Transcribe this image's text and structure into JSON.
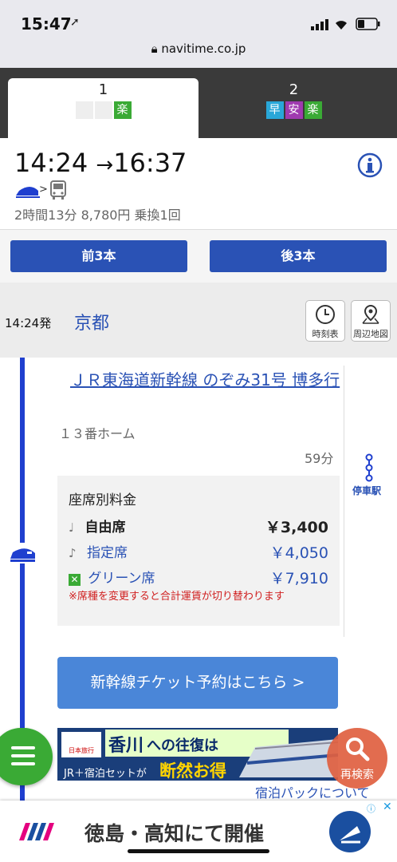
{
  "status": {
    "time": "15:47",
    "url": "navitime.co.jp"
  },
  "tabs": [
    {
      "num": "1",
      "badges": [
        "",
        "",
        "楽"
      ]
    },
    {
      "num": "2",
      "badges": [
        "早",
        "安",
        "楽"
      ]
    }
  ],
  "summary": {
    "depart": "14:24",
    "arrow": "→",
    "arrive": "16:37",
    "gt": ">",
    "details": "2時間13分 8,780円 乗換1回"
  },
  "nav": {
    "prev": "前3本",
    "next": "後3本"
  },
  "station": {
    "time": "14:24発",
    "name": "京都",
    "timetable": "時刻表",
    "map": "周辺地図"
  },
  "train": {
    "name": "ＪＲ東海道新幹線 のぞみ31号 博多行",
    "platform": "１３番ホーム",
    "duration": "59分",
    "stops": "停車駅"
  },
  "seats": {
    "title": "座席別料金",
    "rows": [
      {
        "label": "自由席",
        "price": "￥3,400"
      },
      {
        "label": "指定席",
        "price": "￥4,050"
      },
      {
        "label": "グリーン席",
        "price": "￥7,910"
      }
    ],
    "note": "※席種を変更すると合計運賃が切り替わります"
  },
  "ticket_button": "新幹線チケット予約はこちら >",
  "banner": {
    "logo": "日本旅行",
    "dest": "香川",
    "rest": "への往復は",
    "sub": "JR＋宿泊セットが",
    "strong": "断然お得"
  },
  "reroute": "再検索",
  "pack": "宿泊パックについて",
  "ad": {
    "text": "徳島・高知にて開催"
  },
  "colors": {
    "accent": "#2a52b5",
    "green": "#3aaa35",
    "cyan": "#29a7d8",
    "purple": "#7a2fa8",
    "pink": "#e4007f",
    "red": "#e06040"
  }
}
